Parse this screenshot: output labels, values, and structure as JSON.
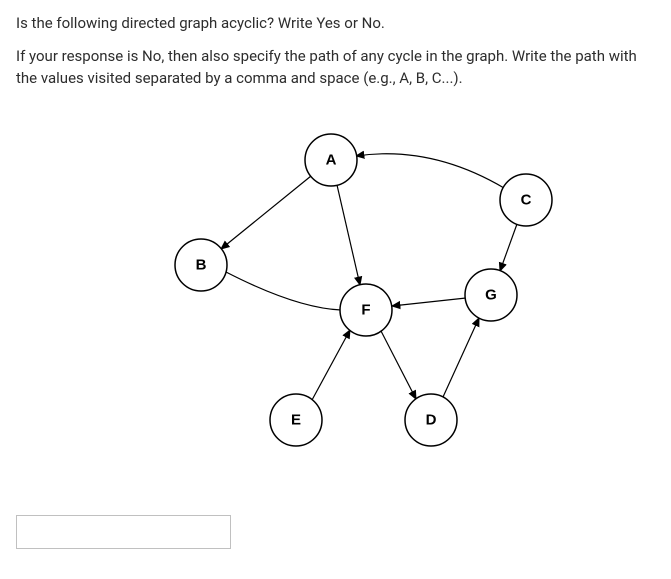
{
  "question": {
    "line1": "Is the following directed graph acyclic? Write Yes or No.",
    "line2": "If your response is No, then also specify the path of any cycle in the graph. Write the path with the values visited separated by a comma and space (e.g., A, B, C...)."
  },
  "graph": {
    "nodes": {
      "A": "A",
      "B": "B",
      "C": "C",
      "D": "D",
      "E": "E",
      "F": "F",
      "G": "G"
    }
  },
  "answer_value": ""
}
